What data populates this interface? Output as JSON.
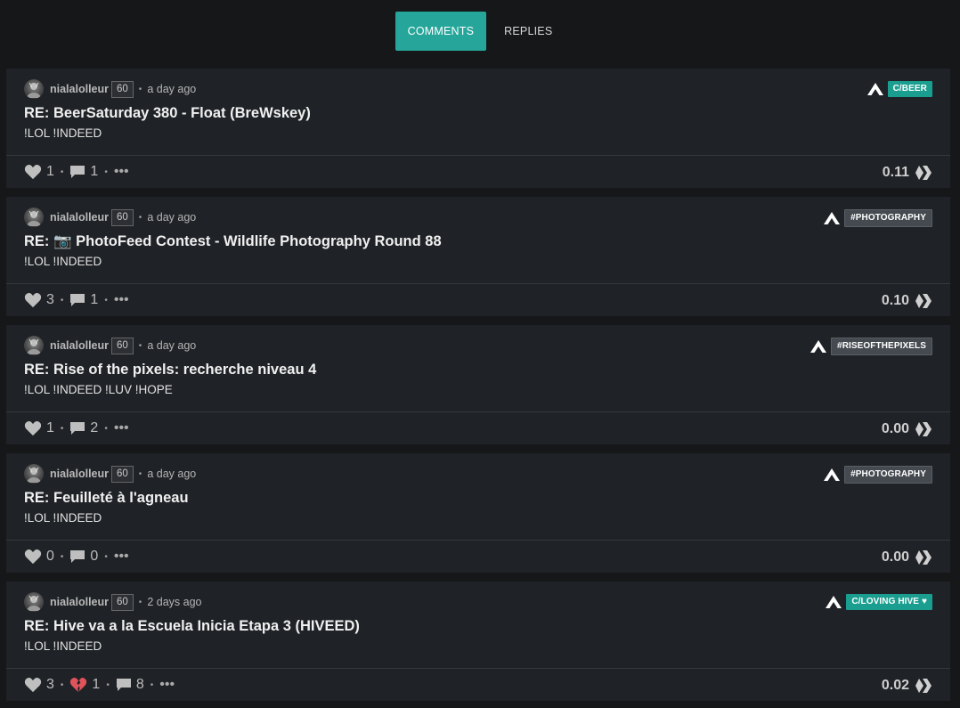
{
  "tabs": [
    {
      "label": "COMMENTS",
      "active": true
    },
    {
      "label": "REPLIES",
      "active": false
    }
  ],
  "accent_color": "#26a69a",
  "comments": [
    {
      "author": "nialalolleur",
      "reputation": "60",
      "time": "a day ago",
      "community_tag": "C/BEER",
      "tag_style": "teal",
      "title": "RE: BeerSaturday 380 - Float (BreWskey)",
      "body": "!LOL !INDEED",
      "likes": "1",
      "dislikes": null,
      "replies": "1",
      "payout": "0.11"
    },
    {
      "author": "nialalolleur",
      "reputation": "60",
      "time": "a day ago",
      "community_tag": "#PHOTOGRAPHY",
      "tag_style": "gray",
      "title": "RE: 📷 PhotoFeed Contest - Wildlife Photography Round 88",
      "body": "!LOL !INDEED",
      "likes": "3",
      "dislikes": null,
      "replies": "1",
      "payout": "0.10"
    },
    {
      "author": "nialalolleur",
      "reputation": "60",
      "time": "a day ago",
      "community_tag": "#RISEOFTHEPIXELS",
      "tag_style": "gray",
      "title": "RE: Rise of the pixels: recherche niveau 4",
      "body": "!LOL !INDEED !LUV !HOPE",
      "likes": "1",
      "dislikes": null,
      "replies": "2",
      "payout": "0.00"
    },
    {
      "author": "nialalolleur",
      "reputation": "60",
      "time": "a day ago",
      "community_tag": "#PHOTOGRAPHY",
      "tag_style": "gray",
      "title": "RE: Feuilleté à l'agneau",
      "body": "!LOL !INDEED",
      "likes": "0",
      "dislikes": null,
      "replies": "0",
      "payout": "0.00"
    },
    {
      "author": "nialalolleur",
      "reputation": "60",
      "time": "2 days ago",
      "community_tag": "C/LOVING HIVE ♥",
      "tag_style": "teal",
      "title": "RE: Hive va a la Escuela Inicia Etapa 3 (HIVEED)",
      "body": "!LOL !INDEED",
      "likes": "3",
      "dislikes": "1",
      "replies": "8",
      "payout": "0.02"
    }
  ]
}
